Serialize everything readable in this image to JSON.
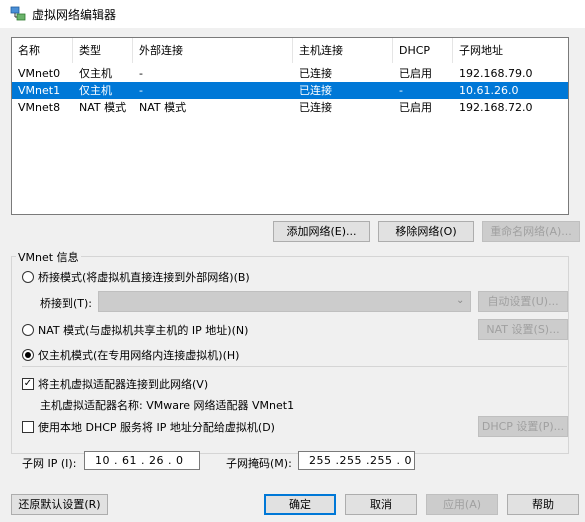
{
  "window": {
    "title": "虚拟网络编辑器",
    "icon": "vmware-network-icon"
  },
  "table": {
    "columns": [
      "名称",
      "类型",
      "外部连接",
      "主机连接",
      "DHCP",
      "子网地址"
    ],
    "rows": [
      {
        "name": "VMnet0",
        "type": "仅主机",
        "external": "-",
        "host": "已连接",
        "dhcp": "已启用",
        "subnet": "192.168.79.0",
        "selected": false
      },
      {
        "name": "VMnet1",
        "type": "仅主机",
        "external": "-",
        "host": "已连接",
        "dhcp": "-",
        "subnet": "10.61.26.0",
        "selected": true
      },
      {
        "name": "VMnet8",
        "type": "NAT 模式",
        "external": "NAT 模式",
        "host": "已连接",
        "dhcp": "已启用",
        "subnet": "192.168.72.0",
        "selected": false
      }
    ]
  },
  "buttons": {
    "add_network": "添加网络(E)...",
    "remove_network": "移除网络(O)",
    "rename_network": "重命名网络(A)...",
    "auto_settings": "自动设置(U)...",
    "nat_settings": "NAT 设置(S)...",
    "dhcp_settings": "DHCP 设置(P)...",
    "restore_defaults": "还原默认设置(R)",
    "ok": "确定",
    "cancel": "取消",
    "apply": "应用(A)",
    "help": "帮助"
  },
  "vmnet_info": {
    "group_label": "VMnet 信息",
    "bridged_label": "桥接模式(将虚拟机直接连接到外部网络)(B)",
    "bridged_to_label": "桥接到(T):",
    "bridged_to_value": "",
    "nat_label": "NAT 模式(与虚拟机共享主机的 IP 地址)(N)",
    "hostonly_label": "仅主机模式(在专用网络内连接虚拟机)(H)",
    "selected_mode": "hostonly",
    "connect_adapter_label": "将主机虚拟适配器连接到此网络(V)",
    "connect_adapter_checked": true,
    "adapter_name_label": "主机虚拟适配器名称: VMware 网络适配器 VMnet1",
    "use_dhcp_label": "使用本地 DHCP 服务将 IP 地址分配给虚拟机(D)",
    "use_dhcp_checked": false,
    "subnet_ip_label": "子网 IP (I):",
    "subnet_ip_value": "10 . 61 . 26 . 0",
    "subnet_mask_label": "子网掩码(M):",
    "subnet_mask_value": "255 .255 .255 . 0"
  },
  "colors": {
    "selection": "#0078d7",
    "window_bg": "#f0f0f0",
    "disabled_text": "#a0a0a0"
  }
}
